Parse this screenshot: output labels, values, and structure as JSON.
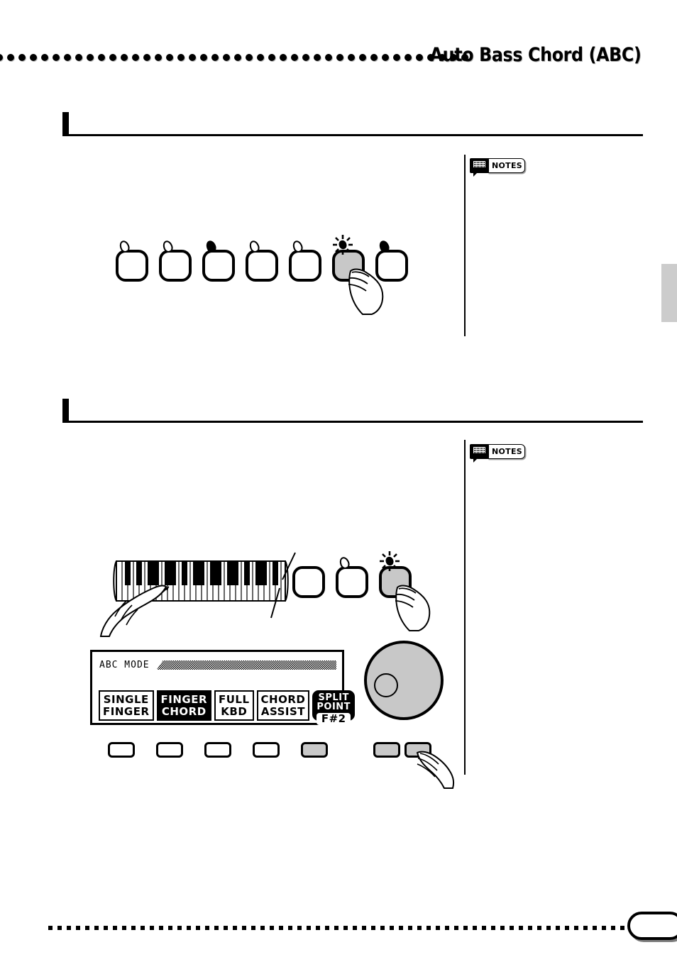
{
  "header": {
    "title": "Auto Bass Chord (ABC)",
    "dot_count": 42,
    "dot_color": "#000000"
  },
  "margin_tab": {
    "color": "#cccccc"
  },
  "sections": [
    {
      "name": "section-one",
      "notes_badge": {
        "label": "NOTES",
        "icon": "notes-bubble-icon"
      },
      "button_row": {
        "name": "abc-button-row",
        "buttons": [
          {
            "label": "",
            "led": "off",
            "state": "normal"
          },
          {
            "label": "",
            "led": "off",
            "state": "normal"
          },
          {
            "label": "",
            "led": "filled",
            "state": "normal"
          },
          {
            "label": "",
            "led": "off",
            "state": "normal"
          },
          {
            "label": "",
            "led": "off",
            "state": "normal"
          },
          {
            "label": "",
            "led": "lit",
            "state": "pressed"
          },
          {
            "label": "",
            "led": "filled",
            "state": "normal"
          }
        ]
      }
    },
    {
      "name": "section-two",
      "notes_badge": {
        "label": "NOTES",
        "icon": "notes-bubble-icon"
      },
      "button_row": {
        "name": "mode-button-row",
        "buttons": [
          {
            "label": "",
            "led": "off",
            "state": "normal"
          },
          {
            "label": "",
            "led": "off",
            "state": "normal"
          },
          {
            "label": "",
            "led": "lit",
            "state": "pressed"
          }
        ]
      }
    }
  ],
  "keyboard": {
    "name": "piano-keyboard-diagram",
    "white_key_count": 29,
    "hand_pointer": true
  },
  "lcd": {
    "title": "ABC MODE",
    "banner": "hatched-banner",
    "cells": [
      {
        "name": "single-finger",
        "line1": "SINGLE",
        "line2": "FINGER",
        "selected": false
      },
      {
        "name": "finger-chord",
        "line1": "FINGER",
        "line2": "CHORD",
        "selected": true
      },
      {
        "name": "full-kbd",
        "line1": "FULL",
        "line2": "KBD",
        "selected": false
      },
      {
        "name": "chord-assist",
        "line1": "CHORD",
        "line2": "ASSIST",
        "selected": false
      }
    ],
    "split_point": {
      "name": "split-point",
      "line1": "SPLIT",
      "line2": "POINT",
      "value": "F#2"
    }
  },
  "lcd_buttons": {
    "name": "lcd-soft-buttons",
    "left_group": [
      {
        "gray": false
      },
      {
        "gray": false
      },
      {
        "gray": false
      },
      {
        "gray": false
      },
      {
        "gray": true
      }
    ],
    "right_group": [
      {
        "gray": true
      },
      {
        "gray": true
      }
    ]
  },
  "dial": {
    "name": "data-dial",
    "color": "#c8c8c8"
  },
  "footer": {
    "dot_count": 64,
    "page_number": ""
  }
}
